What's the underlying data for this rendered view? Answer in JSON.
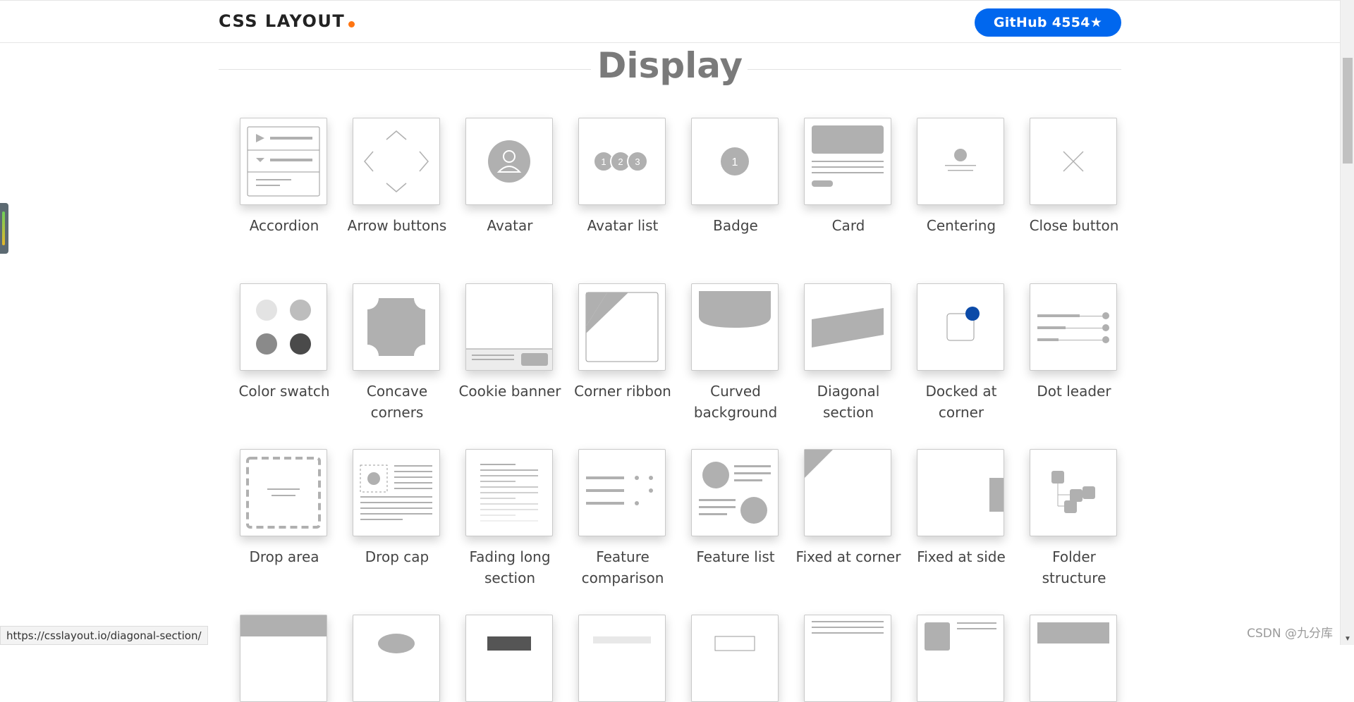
{
  "header": {
    "logo_text": "CSS LAYOUT",
    "logo_dot_color": "#ff7512",
    "github_button": "GitHub 4554★",
    "github_color": "#0067ee"
  },
  "section": {
    "title": "Display"
  },
  "items": [
    {
      "label": "Accordion",
      "icon": "accordion-icon"
    },
    {
      "label": "Arrow buttons",
      "icon": "arrow-buttons-icon"
    },
    {
      "label": "Avatar",
      "icon": "avatar-icon"
    },
    {
      "label": "Avatar list",
      "icon": "avatar-list-icon"
    },
    {
      "label": "Badge",
      "icon": "badge-icon"
    },
    {
      "label": "Card",
      "icon": "card-icon"
    },
    {
      "label": "Centering",
      "icon": "centering-icon"
    },
    {
      "label": "Close button",
      "icon": "close-icon"
    },
    {
      "label": "Color swatch",
      "icon": "color-swatch-icon"
    },
    {
      "label": "Concave corners",
      "icon": "concave-corners-icon"
    },
    {
      "label": "Cookie banner",
      "icon": "cookie-banner-icon"
    },
    {
      "label": "Corner ribbon",
      "icon": "corner-ribbon-icon"
    },
    {
      "label": "Curved background",
      "icon": "curved-background-icon"
    },
    {
      "label": "Diagonal section",
      "icon": "diagonal-section-icon"
    },
    {
      "label": "Docked at corner",
      "icon": "docked-at-corner-icon"
    },
    {
      "label": "Dot leader",
      "icon": "dot-leader-icon"
    },
    {
      "label": "Drop area",
      "icon": "drop-area-icon"
    },
    {
      "label": "Drop cap",
      "icon": "drop-cap-icon"
    },
    {
      "label": "Fading long section",
      "icon": "fading-long-section-icon"
    },
    {
      "label": "Feature comparison",
      "icon": "feature-comparison-icon"
    },
    {
      "label": "Feature list",
      "icon": "feature-list-icon"
    },
    {
      "label": "Fixed at corner",
      "icon": "fixed-at-corner-icon"
    },
    {
      "label": "Fixed at side",
      "icon": "fixed-at-side-icon"
    },
    {
      "label": "Folder structure",
      "icon": "folder-structure-icon"
    }
  ],
  "avatar_list_numbers": [
    "1",
    "2",
    "3"
  ],
  "badge_number": "1",
  "docked_dot_color": "#0b4aa8",
  "status_url": "https://csslayout.io/diagonal-section/",
  "watermark": "CSDN @九分库"
}
